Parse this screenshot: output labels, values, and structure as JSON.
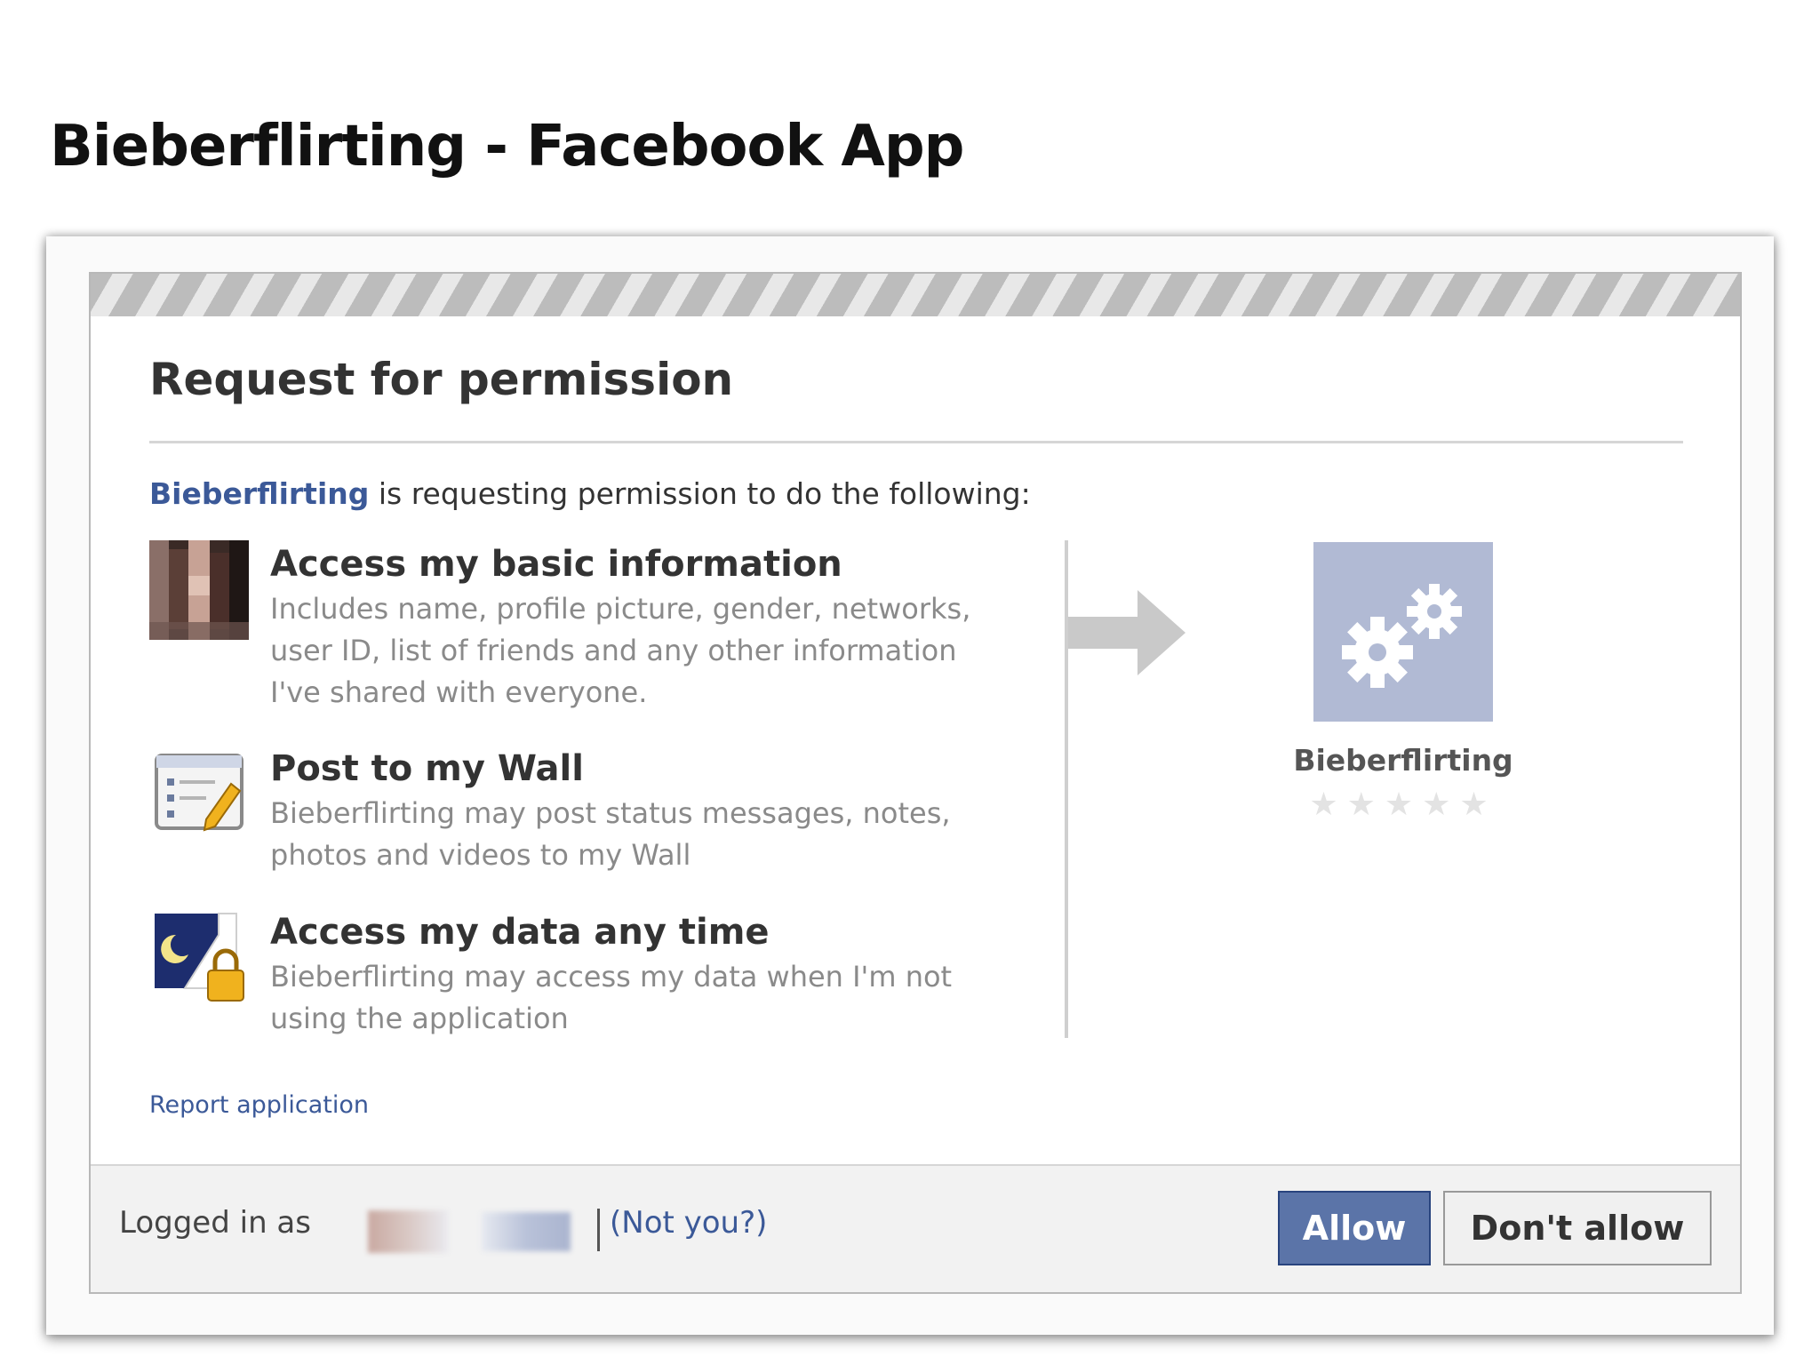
{
  "slide": {
    "title": "Bieberflirting - Facebook App"
  },
  "dialog": {
    "title": "Request for permission",
    "intro_app": "Bieberflirting",
    "intro_text": " is requesting permission to do the following:",
    "permissions": [
      {
        "icon": "profile-photo-icon",
        "title": "Access my basic information",
        "description": "Includes name, profile picture, gender, networks, user ID, list of friends and any other information I've shared with everyone."
      },
      {
        "icon": "wall-post-icon",
        "title": "Post to my Wall",
        "description": "Bieberflirting may post status messages, notes, photos and videos to my Wall"
      },
      {
        "icon": "offline-access-icon",
        "title": "Access my data any time",
        "description": "Bieberflirting may access my data when I'm not using the application"
      }
    ],
    "app": {
      "icon": "gears-icon",
      "name": "Bieberflirting",
      "stars": "★★★★★",
      "rating": 0,
      "rating_max": 5
    },
    "report_link": "Report application",
    "footer": {
      "logged_in_label": "Logged in as",
      "not_you": "(Not you?)",
      "allow_label": "Allow",
      "deny_label": "Don't allow"
    }
  },
  "colors": {
    "link": "#3b5998",
    "allow_button": "#5b74a8",
    "app_icon_bg": "#b1bad4"
  }
}
